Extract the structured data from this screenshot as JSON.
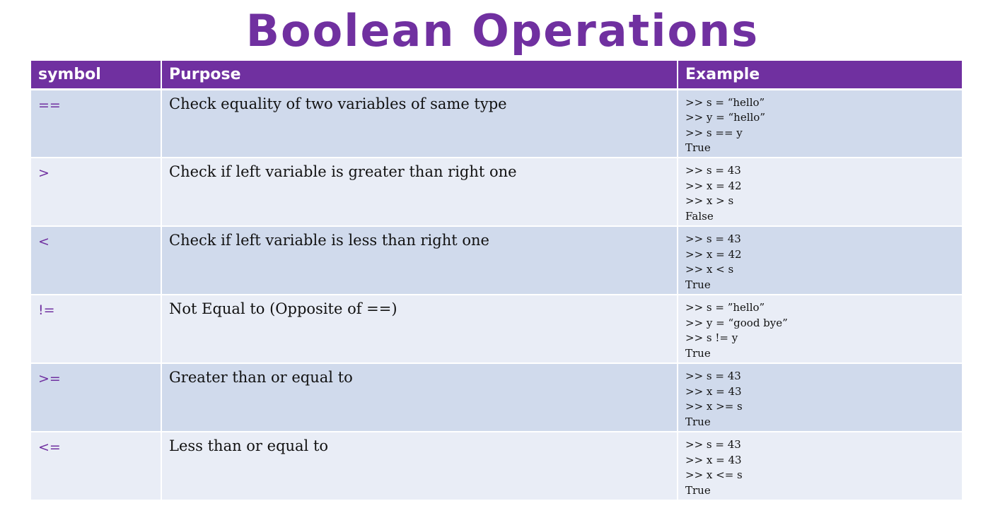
{
  "title": "Boolean Operations",
  "colors": {
    "accent": "#7030a0",
    "row_odd": "#d0daec",
    "row_even": "#e9edf6"
  },
  "table": {
    "headers": [
      "symbol",
      "Purpose",
      "Example"
    ],
    "rows": [
      {
        "symbol": "==",
        "purpose": "Check equality of two variables of same type",
        "example": [
          ">> s = “hello”",
          ">> y = “hello”",
          ">> s == y",
          "True"
        ]
      },
      {
        "symbol": ">",
        "purpose": "Check if left variable is greater than right one",
        "example": [
          ">> s = 43",
          ">> x = 42",
          ">> x > s",
          "False"
        ]
      },
      {
        "symbol": "<",
        "purpose": "Check if left variable is less than right one",
        "example": [
          ">> s = 43",
          ">> x = 42",
          ">> x < s",
          "True"
        ]
      },
      {
        "symbol": "!=",
        "purpose": "Not Equal to (Opposite of ==)",
        "example": [
          ">> s = ”hello”",
          ">> y = “good bye”",
          ">> s != y",
          "True"
        ]
      },
      {
        "symbol": ">=",
        "purpose": "Greater than or equal to",
        "example": [
          ">> s = 43",
          ">> x = 43",
          ">> x >= s",
          "True"
        ]
      },
      {
        "symbol": "<=",
        "purpose": "Less than or equal to",
        "example": [
          ">> s = 43",
          ">> x = 43",
          ">> x <= s",
          "True"
        ]
      }
    ]
  }
}
